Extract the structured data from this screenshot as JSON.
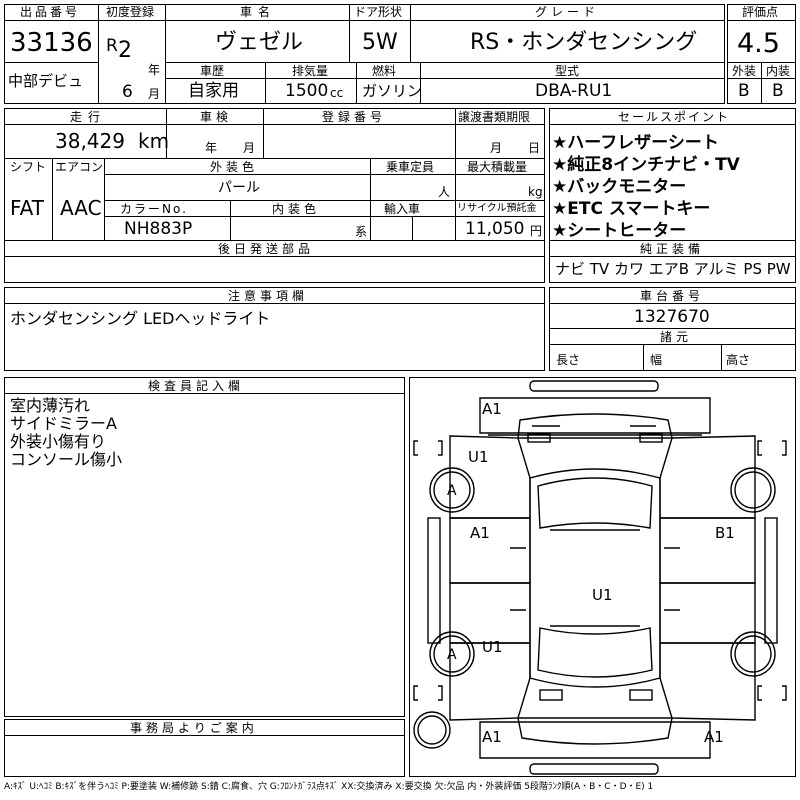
{
  "header": {
    "lot_label": "出品番号",
    "lot_number": "33136",
    "debut_note": "中部デビュ",
    "reg_label": "初度登録",
    "era": "R",
    "reg_year": "2",
    "year_unit": "年",
    "reg_month": "6",
    "month_unit": "月",
    "model_label": "車名",
    "model": "ヴェゼル",
    "door_label": "ドア形状",
    "door": "5W",
    "grade_label": "グレード",
    "grade": "RS・ホンダセンシング",
    "score_label": "評価点",
    "score": "4.5",
    "history_label": "車歴",
    "history": "自家用",
    "displacement_label": "排気量",
    "displacement": "1500",
    "displacement_unit": "cc",
    "fuel_label": "燃料",
    "fuel": "ガソリン",
    "type_label": "型式",
    "type": "DBA-RU1",
    "exterior_label": "外装",
    "exterior_grade": "B",
    "interior_label": "内装",
    "interior_grade": "B"
  },
  "row2": {
    "mileage_label": "走行",
    "mileage": "38,429",
    "mileage_unit": "km",
    "inspection_label": "車検",
    "insp_year_unit": "年",
    "insp_month_unit": "月",
    "plate_label": "登録番号",
    "transfer_label": "譲渡書類期限",
    "transfer_month_unit": "月",
    "transfer_day_unit": "日",
    "shift_label": "シフト",
    "shift": "FAT",
    "ac_label": "エアコン",
    "ac": "AAC",
    "color_label": "外装色",
    "color": "パール",
    "capacity_label": "乗車定員",
    "capacity_unit": "人",
    "load_label": "最大積載量",
    "load_unit": "kg",
    "color_no_label": "カラーNo.",
    "color_no": "NH883P",
    "interior_color_label": "内装色",
    "interior_color_unit": "系",
    "import_label": "輸入車",
    "recycle_label": "リサイクル預託金",
    "recycle_fee": "11,050",
    "recycle_unit": "円",
    "later_parts_label": "後日発送部品"
  },
  "sales_points": {
    "label": "セールスポイント",
    "items": [
      "★ハーフレザーシート",
      "★純正8インチナビ・TV",
      "★バックモニター",
      "★ETC スマートキー",
      "★シートヒーター"
    ]
  },
  "equipment": {
    "label": "純正装備",
    "value": "ナビ TV カワ エアB アルミ PS PW"
  },
  "notes": {
    "label": "注意事項欄",
    "text": "ホンダセンシング LEDヘッドライト"
  },
  "chassis": {
    "label": "車台番号",
    "number": "1327670",
    "dims_label": "諸元",
    "length_label": "長さ",
    "width_label": "幅",
    "height_label": "高さ"
  },
  "inspector": {
    "label": "検査員記入欄",
    "lines": [
      "室内薄汚れ",
      "サイドミラーA",
      "外装小傷有り",
      "コンソール傷小"
    ]
  },
  "office": {
    "label": "事務局よりご案内"
  },
  "diagram": {
    "front_left": "A1",
    "left_mirror": "U1",
    "wheel_fl": "A",
    "left_front_door": "A1",
    "right_front_door": "B1",
    "roof": "U1",
    "wheel_rl": "A",
    "left_rear_door": "U1",
    "rear_left": "A1",
    "rear_right": "A1"
  },
  "legend": "A:ｷｽﾞ U:ﾍｺﾐ B:ｷｽﾞを伴うﾍｺﾐ P:要塗装 W:補修跡 S:錆 C:腐食、穴 G:ﾌﾛﾝﾄｶﾞﾗｽ点ｷｽﾞ XX:交換済み X:要交換 欠:欠品 内・外装評価 5段階ﾗﾝｸ順(A・B・C・D・E) 1"
}
